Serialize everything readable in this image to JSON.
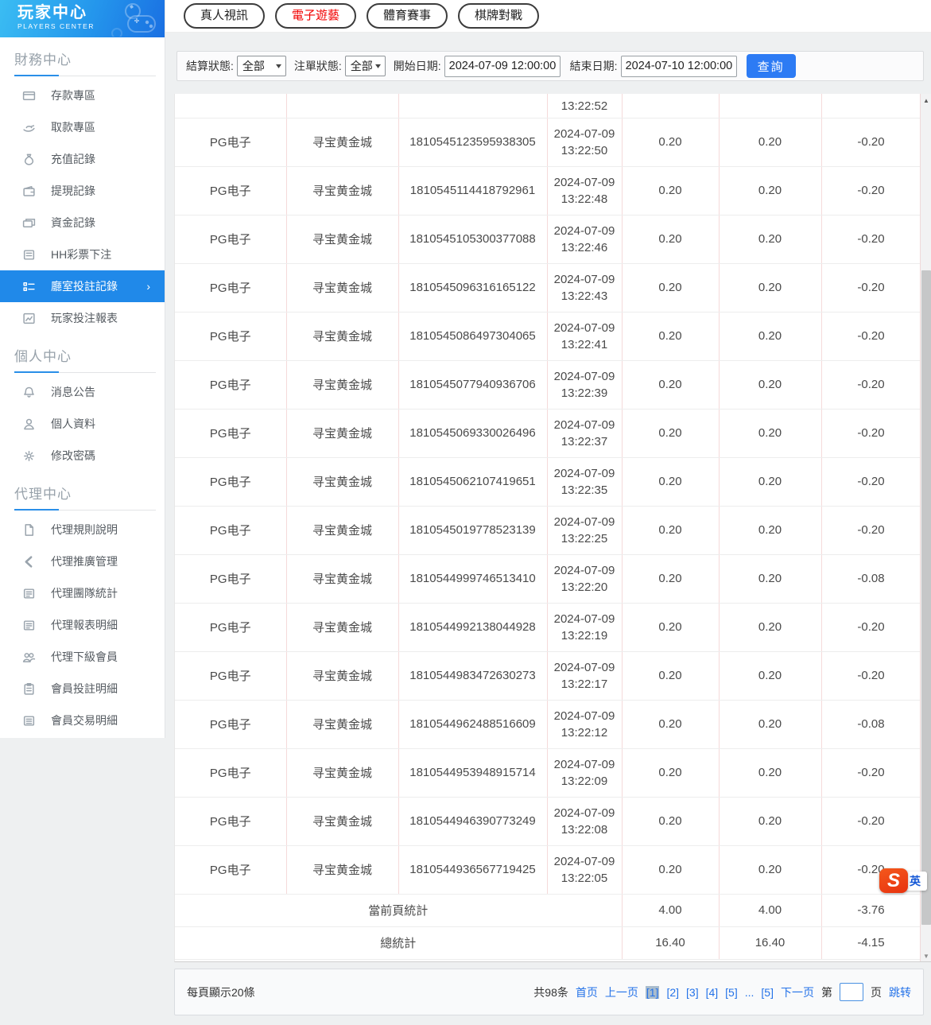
{
  "sidebar": {
    "title": "玩家中心",
    "subtitle": "PLAYERS CENTER",
    "sections": [
      {
        "title": "財務中心",
        "items": [
          {
            "icon": "deposit-icon",
            "label": "存款專區"
          },
          {
            "icon": "withdraw-icon",
            "label": "取款專區"
          },
          {
            "icon": "recharge-record-icon",
            "label": "充值記錄"
          },
          {
            "icon": "withdrawal-record-icon",
            "label": "提現記錄"
          },
          {
            "icon": "funds-record-icon",
            "label": "資金記錄"
          },
          {
            "icon": "lottery-bet-icon",
            "label": "HH彩票下注"
          },
          {
            "icon": "room-bet-record-icon",
            "label": "廳室投註記錄",
            "active": true
          },
          {
            "icon": "player-bet-report-icon",
            "label": "玩家投注報表"
          }
        ]
      },
      {
        "title": "個人中心",
        "items": [
          {
            "icon": "announcement-bell-icon",
            "label": "消息公告"
          },
          {
            "icon": "profile-person-icon",
            "label": "個人資料"
          },
          {
            "icon": "password-gear-icon",
            "label": "修改密碼"
          }
        ]
      },
      {
        "title": "代理中心",
        "items": [
          {
            "icon": "agent-rules-doc-icon",
            "label": "代理規則說明"
          },
          {
            "icon": "agent-promo-share-icon",
            "label": "代理推廣管理"
          },
          {
            "icon": "agent-team-stats-icon",
            "label": "代理團隊統計"
          },
          {
            "icon": "agent-report-detail-icon",
            "label": "代理報表明細"
          },
          {
            "icon": "agent-members-users-icon",
            "label": "代理下級會員"
          },
          {
            "icon": "member-bet-detail-icon",
            "label": "會員投註明細"
          },
          {
            "icon": "member-transaction-icon",
            "label": "會員交易明細"
          }
        ]
      }
    ]
  },
  "tabs": [
    {
      "label": "真人視訊",
      "active": false
    },
    {
      "label": "電子遊藝",
      "active": true
    },
    {
      "label": "體育賽事",
      "active": false
    },
    {
      "label": "棋牌對戰",
      "active": false
    }
  ],
  "filters": {
    "settle_status_label": "結算狀態:",
    "settle_status_value": "全部",
    "order_status_label": "注單狀態:",
    "order_status_value": "全部",
    "start_date_label": "開始日期:",
    "start_date_value": "2024-07-09 12:00:00",
    "end_date_label": "結束日期:",
    "end_date_value": "2024-07-10 12:00:00",
    "search_button": "查詢"
  },
  "table": {
    "partial_row_time": "13:22:52",
    "rows": [
      {
        "platform": "PG电子",
        "game": "寻宝黄金城",
        "order_no": "1810545123595938305",
        "date": "2024-07-09",
        "time": "13:22:50",
        "bet": "0.20",
        "valid": "0.20",
        "profit": "-0.20"
      },
      {
        "platform": "PG电子",
        "game": "寻宝黄金城",
        "order_no": "1810545114418792961",
        "date": "2024-07-09",
        "time": "13:22:48",
        "bet": "0.20",
        "valid": "0.20",
        "profit": "-0.20"
      },
      {
        "platform": "PG电子",
        "game": "寻宝黄金城",
        "order_no": "1810545105300377088",
        "date": "2024-07-09",
        "time": "13:22:46",
        "bet": "0.20",
        "valid": "0.20",
        "profit": "-0.20"
      },
      {
        "platform": "PG电子",
        "game": "寻宝黄金城",
        "order_no": "1810545096316165122",
        "date": "2024-07-09",
        "time": "13:22:43",
        "bet": "0.20",
        "valid": "0.20",
        "profit": "-0.20"
      },
      {
        "platform": "PG电子",
        "game": "寻宝黄金城",
        "order_no": "1810545086497304065",
        "date": "2024-07-09",
        "time": "13:22:41",
        "bet": "0.20",
        "valid": "0.20",
        "profit": "-0.20"
      },
      {
        "platform": "PG电子",
        "game": "寻宝黄金城",
        "order_no": "1810545077940936706",
        "date": "2024-07-09",
        "time": "13:22:39",
        "bet": "0.20",
        "valid": "0.20",
        "profit": "-0.20"
      },
      {
        "platform": "PG电子",
        "game": "寻宝黄金城",
        "order_no": "1810545069330026496",
        "date": "2024-07-09",
        "time": "13:22:37",
        "bet": "0.20",
        "valid": "0.20",
        "profit": "-0.20"
      },
      {
        "platform": "PG电子",
        "game": "寻宝黄金城",
        "order_no": "1810545062107419651",
        "date": "2024-07-09",
        "time": "13:22:35",
        "bet": "0.20",
        "valid": "0.20",
        "profit": "-0.20"
      },
      {
        "platform": "PG电子",
        "game": "寻宝黄金城",
        "order_no": "1810545019778523139",
        "date": "2024-07-09",
        "time": "13:22:25",
        "bet": "0.20",
        "valid": "0.20",
        "profit": "-0.20"
      },
      {
        "platform": "PG电子",
        "game": "寻宝黄金城",
        "order_no": "1810544999746513410",
        "date": "2024-07-09",
        "time": "13:22:20",
        "bet": "0.20",
        "valid": "0.20",
        "profit": "-0.08"
      },
      {
        "platform": "PG电子",
        "game": "寻宝黄金城",
        "order_no": "1810544992138044928",
        "date": "2024-07-09",
        "time": "13:22:19",
        "bet": "0.20",
        "valid": "0.20",
        "profit": "-0.20"
      },
      {
        "platform": "PG电子",
        "game": "寻宝黄金城",
        "order_no": "1810544983472630273",
        "date": "2024-07-09",
        "time": "13:22:17",
        "bet": "0.20",
        "valid": "0.20",
        "profit": "-0.20"
      },
      {
        "platform": "PG电子",
        "game": "寻宝黄金城",
        "order_no": "1810544962488516609",
        "date": "2024-07-09",
        "time": "13:22:12",
        "bet": "0.20",
        "valid": "0.20",
        "profit": "-0.08"
      },
      {
        "platform": "PG电子",
        "game": "寻宝黄金城",
        "order_no": "1810544953948915714",
        "date": "2024-07-09",
        "time": "13:22:09",
        "bet": "0.20",
        "valid": "0.20",
        "profit": "-0.20"
      },
      {
        "platform": "PG电子",
        "game": "寻宝黄金城",
        "order_no": "1810544946390773249",
        "date": "2024-07-09",
        "time": "13:22:08",
        "bet": "0.20",
        "valid": "0.20",
        "profit": "-0.20"
      },
      {
        "platform": "PG电子",
        "game": "寻宝黄金城",
        "order_no": "1810544936567719425",
        "date": "2024-07-09",
        "time": "13:22:05",
        "bet": "0.20",
        "valid": "0.20",
        "profit": "-0.20"
      }
    ],
    "page_summary": {
      "label": "當前頁統計",
      "bet": "4.00",
      "valid": "4.00",
      "profit": "-3.76"
    },
    "total_summary": {
      "label": "總統計",
      "bet": "16.40",
      "valid": "16.40",
      "profit": "-4.15"
    }
  },
  "footer": {
    "page_size_text": "每頁顯示20條",
    "total_text": "共98条",
    "first_label": "首页",
    "prev_label": "上一页",
    "pages": [
      {
        "label": "[1]",
        "current": true
      },
      {
        "label": "[2]"
      },
      {
        "label": "[3]"
      },
      {
        "label": "[4]"
      },
      {
        "label": "[5]"
      },
      {
        "label": "...",
        "ellipsis": true
      },
      {
        "label": "[5]"
      }
    ],
    "next_label": "下一页",
    "jump_prefix": "第",
    "jump_suffix": "页",
    "jump_button": "跳转"
  },
  "ime": {
    "logo": "S",
    "badge": "英"
  }
}
